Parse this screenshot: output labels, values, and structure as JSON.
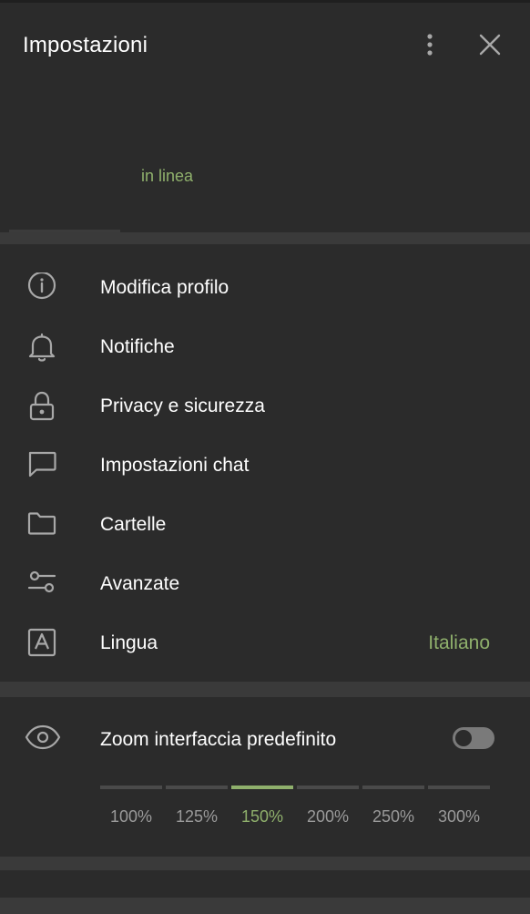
{
  "header": {
    "title": "Impostazioni",
    "status": "in linea"
  },
  "menu": [
    {
      "label": "Modifica profilo",
      "icon": "info-icon"
    },
    {
      "label": "Notifiche",
      "icon": "bell-icon"
    },
    {
      "label": "Privacy e sicurezza",
      "icon": "lock-icon"
    },
    {
      "label": "Impostazioni chat",
      "icon": "chat-bubble-icon"
    },
    {
      "label": "Cartelle",
      "icon": "folder-icon"
    },
    {
      "label": "Avanzate",
      "icon": "sliders-icon"
    },
    {
      "label": "Lingua",
      "icon": "language-icon",
      "value": "Italiano"
    }
  ],
  "zoom": {
    "label": "Zoom interfaccia predefinito",
    "toggle_on": false,
    "options": [
      "100%",
      "125%",
      "150%",
      "200%",
      "250%",
      "300%"
    ],
    "selected": "150%"
  },
  "colors": {
    "background": "#2b2b2b",
    "separator": "#3a3a3a",
    "accent": "#8fb06c",
    "icon": "#a8a8a8"
  }
}
